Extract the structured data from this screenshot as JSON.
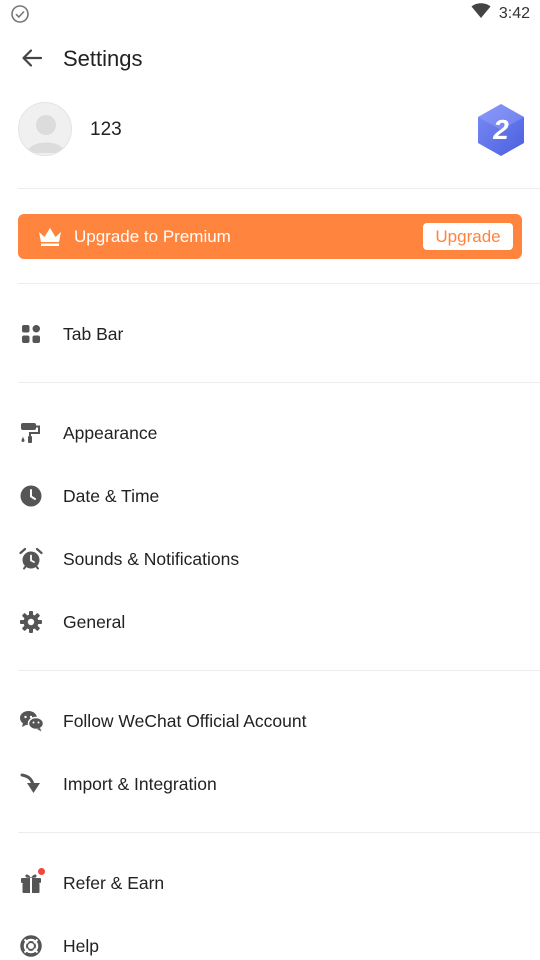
{
  "status_bar": {
    "time": "3:42",
    "left_icon": "check-circle-icon",
    "wifi_icon": "wifi-icon"
  },
  "header": {
    "title": "Settings",
    "back_icon": "arrow-left-icon"
  },
  "profile": {
    "username": "123",
    "avatar_icon": "avatar-icon",
    "level": "2"
  },
  "premium": {
    "label": "Upgrade to Premium",
    "button_label": "Upgrade",
    "icon": "crown-icon",
    "color": "#ff843e"
  },
  "menu": {
    "tab_bar": {
      "label": "Tab Bar",
      "icon": "grid-icon"
    },
    "appearance": {
      "label": "Appearance",
      "icon": "paint-roller-icon"
    },
    "date_time": {
      "label": "Date & Time",
      "icon": "clock-icon"
    },
    "sounds": {
      "label": "Sounds & Notifications",
      "icon": "alarm-clock-icon"
    },
    "general": {
      "label": "General",
      "icon": "gear-icon"
    },
    "wechat": {
      "label": "Follow WeChat Official Account",
      "icon": "wechat-icon"
    },
    "import": {
      "label": "Import & Integration",
      "icon": "import-arrow-icon"
    },
    "refer": {
      "label": "Refer & Earn",
      "icon": "gift-icon"
    },
    "help": {
      "label": "Help",
      "icon": "lifebuoy-icon"
    }
  }
}
